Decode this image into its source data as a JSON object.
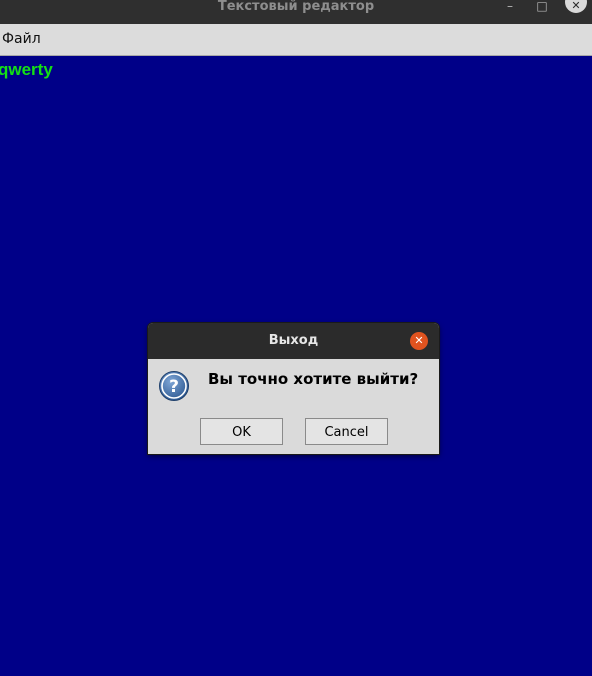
{
  "window": {
    "title": "Текстовый редактор",
    "minimize_glyph": "–",
    "maximize_glyph": "□",
    "close_glyph": "✕"
  },
  "menu": {
    "file_label": "Файл"
  },
  "editor": {
    "content": "qwerty",
    "background": "#000088",
    "text_color": "#14e014"
  },
  "dialog": {
    "title": "Выход",
    "message": "Вы точно хотите выйти?",
    "icon": "question-icon",
    "ok_first": "O",
    "ok_rest": "K",
    "cancel_first": "C",
    "cancel_rest": "ancel",
    "close_glyph": "✕"
  }
}
